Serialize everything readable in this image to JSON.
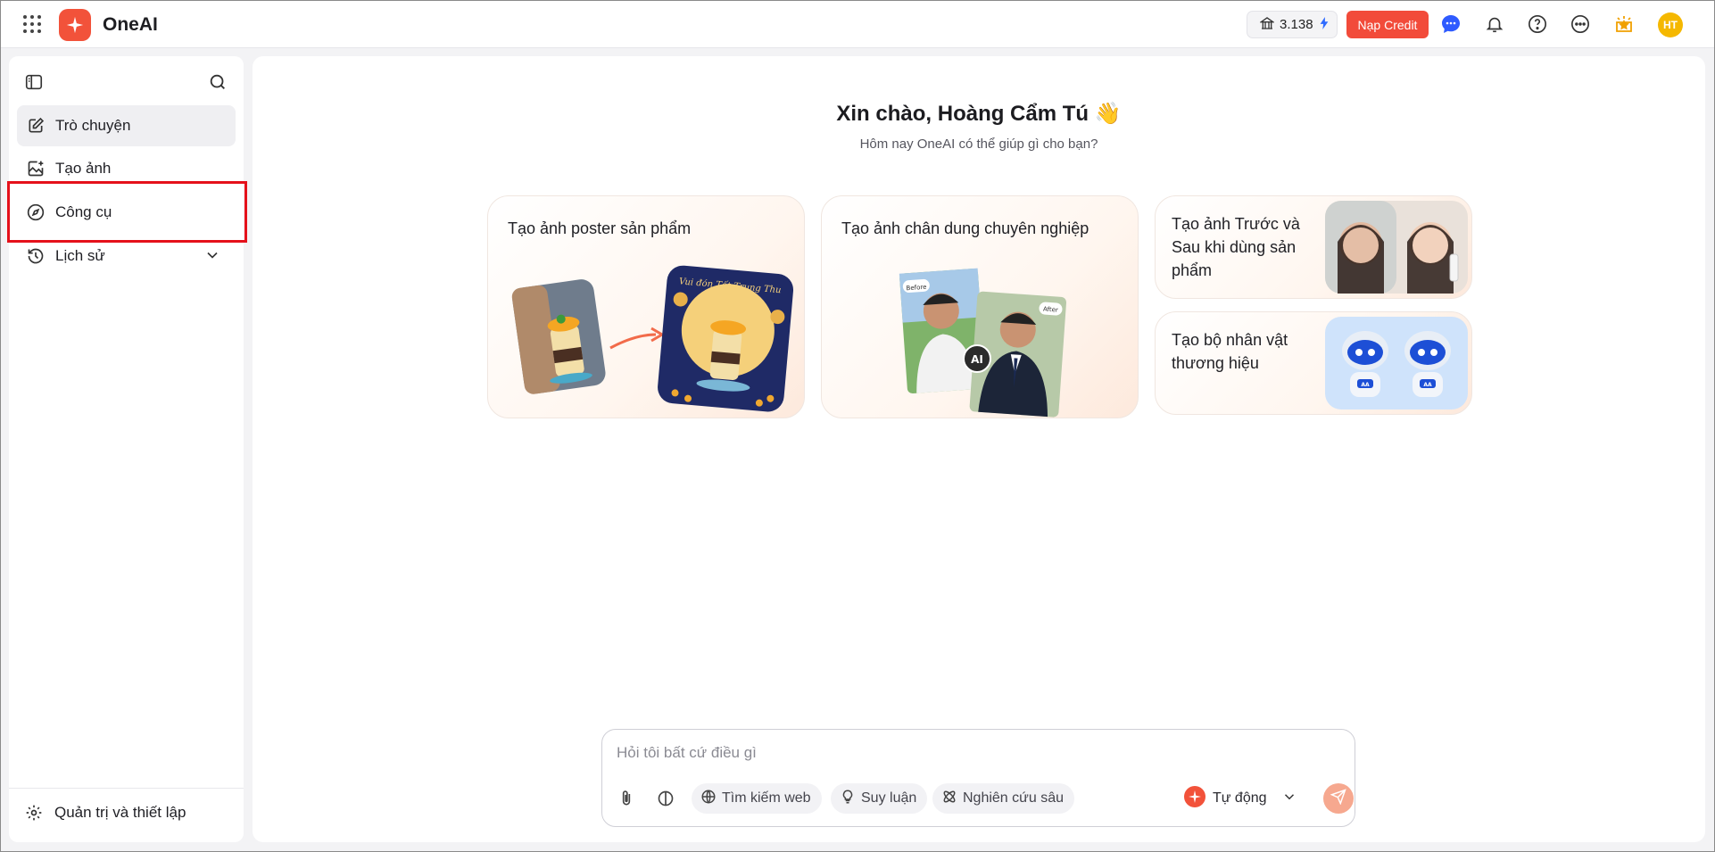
{
  "header": {
    "brand": "OneAI",
    "credits": "3.138",
    "topup_label": "Nạp Credit",
    "avatar_initials": "HT",
    "accent_color": "#f2523a"
  },
  "sidebar": {
    "items": [
      {
        "label": "Trò chuyện",
        "icon": "edit-icon"
      },
      {
        "label": "Tạo ảnh",
        "icon": "image-add-icon"
      },
      {
        "label": "Công cụ",
        "icon": "compass-icon"
      },
      {
        "label": "Lịch sử",
        "icon": "history-icon"
      }
    ],
    "settings_label": "Quản trị và thiết lập"
  },
  "main": {
    "greeting": "Xin chào, Hoàng Cẩm Tú 👋",
    "subtitle": "Hôm nay OneAI có thể giúp gì cho bạn?",
    "cards": [
      {
        "title": "Tạo ảnh poster sản phẩm"
      },
      {
        "title": "Tạo ảnh chân dung chuyên nghiệp"
      },
      {
        "title": "Tạo ảnh Trước và Sau khi dùng sản phẩm"
      },
      {
        "title": "Tạo bộ nhân vật thương hiệu"
      }
    ],
    "poster_text": "Vui đón Tết Trung Thu",
    "portrait_before": "Before",
    "portrait_after": "After",
    "portrait_badge": "AI",
    "mascot_text": "AA"
  },
  "composer": {
    "placeholder": "Hỏi tôi bất cứ điều gì",
    "chips": [
      "Tìm kiếm web",
      "Suy luận",
      "Nghiên cứu sâu"
    ],
    "mode_label": "Tự động"
  }
}
